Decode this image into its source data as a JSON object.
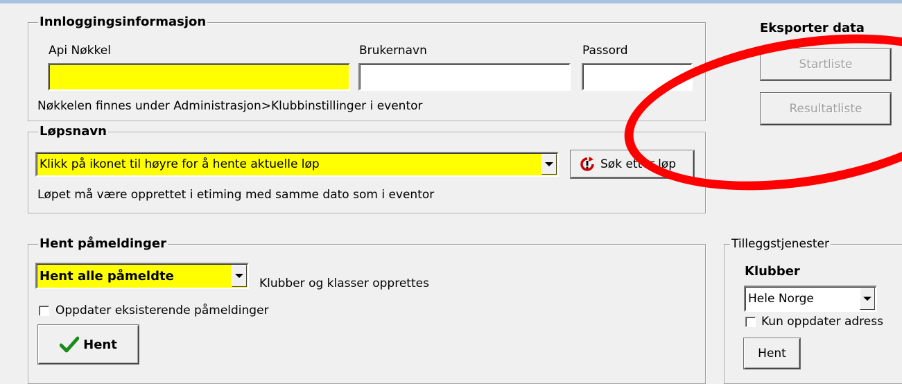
{
  "login": {
    "group_title": "Innloggingsinformasjon",
    "api_key_label": "Api Nøkkel",
    "api_key_value": "",
    "username_label": "Brukernavn",
    "username_value": "",
    "password_label": "Passord",
    "password_value": "",
    "hint": "Nøkkelen finnes under Administrasjon>Klubbinstillinger i eventor"
  },
  "race": {
    "group_title": "Løpsnavn",
    "select_value": "Klikk på ikonet til høyre for å hente aktuelle løp",
    "search_button": "Søk etter løp",
    "search_icon": "refresh-alert-icon",
    "hint": "Løpet må være opprettet i etiming med samme dato som i eventor"
  },
  "registrations": {
    "group_title": "Hent påmeldinger",
    "select_value": "Hent alle påmeldte",
    "note": "Klubber og klasser opprettes",
    "update_checkbox_label": "Oppdater eksisterende påmeldinger",
    "update_checked": false,
    "fetch_button": "Hent",
    "fetch_icon": "checkmark-icon"
  },
  "export": {
    "title": "Eksporter data",
    "start_list_button": "Startliste",
    "result_list_button": "Resultatliste"
  },
  "extras": {
    "group_title": "Tilleggstjenester",
    "clubs_label": "Klubber",
    "clubs_select_value": "Hele Norge",
    "address_checkbox_label": "Kun oppdater adress",
    "address_checked": false,
    "fetch_button": "Hent"
  },
  "colors": {
    "highlight_yellow": "#ffff00",
    "annotation_red": "#ff0000",
    "window_bg": "#f0f0f0"
  }
}
